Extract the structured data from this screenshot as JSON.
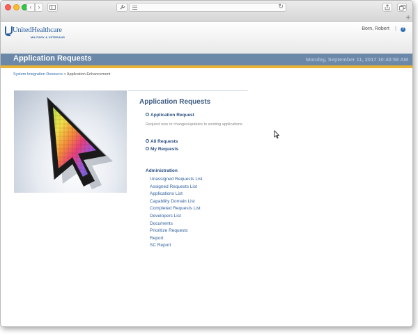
{
  "browser": {
    "nav_back": "‹",
    "nav_forward": "›",
    "tools_glyph": "🔧",
    "reload_glyph": "↻",
    "share_glyph": "⇪",
    "tabs_glyph": "⧉",
    "new_tab_glyph": "+"
  },
  "header": {
    "logo_name": "UnitedHealthcare",
    "logo_sub": "MILITARY & VETERANS",
    "user": "Born, Robert",
    "separator": "|",
    "help": "?"
  },
  "title_bar": {
    "title": "Application Requests",
    "datetime": "Monday, September 11, 2017 10:40:58 AM"
  },
  "breadcrumb": {
    "root": "System Integration Resource",
    "sep": ">",
    "current": "Application Enhancement"
  },
  "main": {
    "title": "Application Requests",
    "application_request": "Application Request",
    "application_request_desc": "Request new or changes/updates to existing applications",
    "all_requests": "All Requests",
    "my_requests": "My Requests"
  },
  "admin": {
    "heading": "Administration",
    "items": [
      "Unassigned Requests List",
      "Assigned Requests List",
      "Applications List",
      "Capability Domain List",
      "Completed Requests List",
      "Developers List",
      "Documents",
      "Prioritize Requests",
      "Report",
      "SC Report"
    ]
  },
  "colors": {
    "title_bar": "#6b88a9",
    "accent_gold": "#e9b333",
    "link_blue": "#2f5f9c",
    "heading_blue": "#3f5b83"
  },
  "icons": [
    "back-arrow-icon",
    "forward-arrow-icon",
    "sidebar-icon",
    "wrench-icon",
    "reader-icon",
    "reload-icon",
    "share-icon",
    "tabs-icon",
    "plus-icon",
    "help-icon",
    "bullet-icon",
    "mouse-cursor-icon"
  ]
}
